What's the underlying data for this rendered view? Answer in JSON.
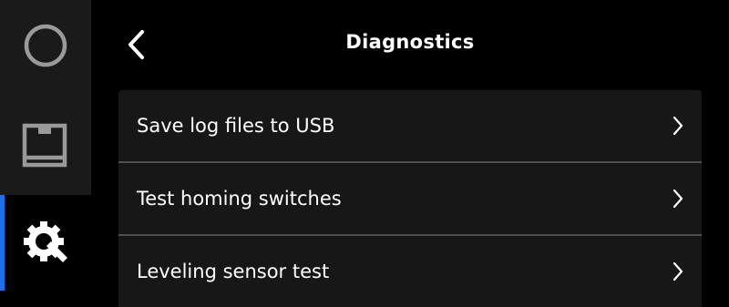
{
  "colors": {
    "background": "#000000",
    "sidebar": "#1a1a1a",
    "accent": "#1f6fe5",
    "panel": "#171717",
    "divider": "#505050"
  },
  "sidebar": {
    "items": [
      {
        "id": "status",
        "icon": "circle-icon"
      },
      {
        "id": "files",
        "icon": "print-job-icon"
      },
      {
        "id": "settings",
        "icon": "wrench-gear-icon",
        "active": true
      }
    ]
  },
  "header": {
    "title": "Diagnostics",
    "back_icon": "chevron-left-icon"
  },
  "menu": {
    "items": [
      {
        "label": "Save log files to USB",
        "icon": "chevron-right-icon"
      },
      {
        "label": "Test homing switches",
        "icon": "chevron-right-icon"
      },
      {
        "label": "Leveling sensor test",
        "icon": "chevron-right-icon"
      }
    ]
  }
}
